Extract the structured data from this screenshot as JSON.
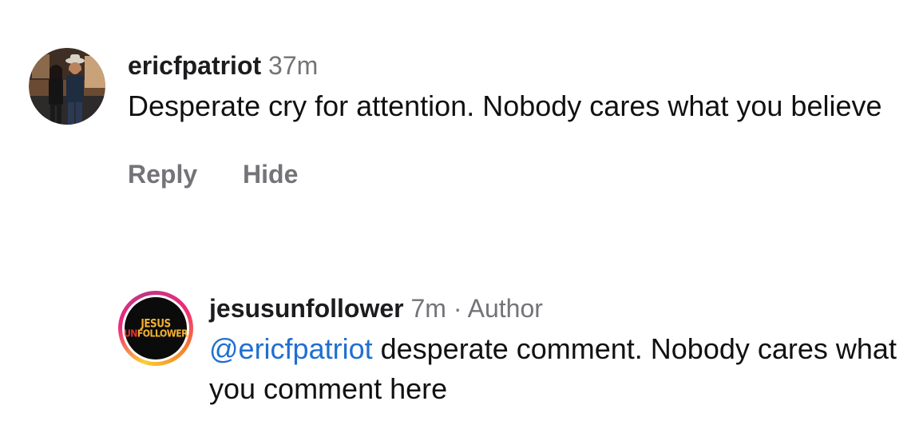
{
  "comments": [
    {
      "username": "ericfpatriot",
      "time": "37m",
      "text": "Desperate cry for attention. Nobody cares what you believe",
      "actions": {
        "reply": "Reply",
        "hide": "Hide"
      }
    },
    {
      "username": "jesusunfollower",
      "time": "7m",
      "separator": "·",
      "badge": "Author",
      "mention": "@ericfpatriot",
      "text": " desperate comment. Nobody cares what you comment here",
      "avatar_logo": {
        "top": "JESUS",
        "bottom_red": "UN",
        "bottom_rest": "FOLLOWER"
      }
    }
  ],
  "colors": {
    "mention": "#1f6fd1",
    "meta": "#737378",
    "logo_gold": "#f2b233",
    "logo_red": "#e0342c"
  }
}
